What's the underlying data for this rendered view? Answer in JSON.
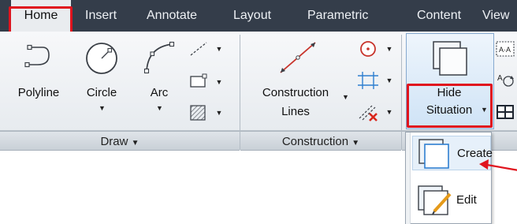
{
  "tabs": [
    "Home",
    "Insert",
    "Annotate",
    "Layout",
    "Parametric",
    "Content",
    "View"
  ],
  "draw_panel": {
    "title": "Draw",
    "tools": [
      "Polyline",
      "Circle",
      "Arc"
    ]
  },
  "construction_panel": {
    "title": "Construction",
    "tool_line1": "Construction",
    "tool_line2": "Lines"
  },
  "hide_situation": {
    "line1": "Hide",
    "line2": "Situation"
  },
  "dropdown_items": [
    "Create",
    "Edit"
  ],
  "colors": {
    "tabbar": "#343d4a",
    "highlight_red": "#e0141e",
    "accent_blue": "#2f7fd0"
  }
}
